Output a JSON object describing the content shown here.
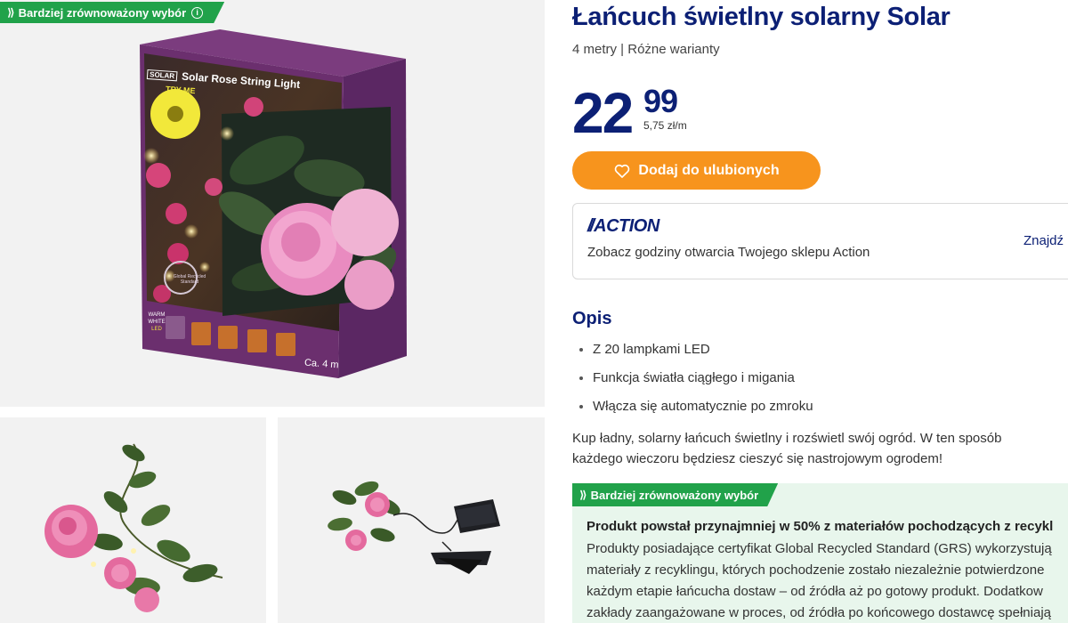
{
  "badge": {
    "eco_label": "Bardziej zrównoważony wybór"
  },
  "product": {
    "title": "Łańcuch świetlny solarny Solar",
    "subtitle": "4 metry | Różne warianty"
  },
  "price": {
    "integer": "22",
    "decimal": "99",
    "unit_price": "5,75 zł/m"
  },
  "favorite_button": {
    "label": "Dodaj do ulubionych"
  },
  "store": {
    "logo": "ACTION",
    "text": "Zobacz godziny otwarcia Twojego sklepu Action",
    "link": "Znajdź"
  },
  "package": {
    "brand": "SOLAR",
    "name": "Solar Rose String Light",
    "try_me": "TRY ME",
    "length": "Ca. 4 m",
    "warm_white": "WARM WHITE",
    "led": "LED",
    "recycled": "Global Recycled Standard"
  },
  "description": {
    "heading": "Opis",
    "features": [
      "Z 20 lampkami LED",
      "Funkcja światła ciągłego i migania",
      "Włącza się automatycznie po zmroku"
    ],
    "text": "Kup ładny, solarny łańcuch świetlny i rozświetl swój ogród. W ten sposób każdego wieczoru będziesz cieszyć się nastrojowym ogrodem!"
  },
  "sustainability": {
    "label": "Bardziej zrównoważony wybór",
    "title": "Produkt powstał przynajmniej w 50% z materiałów pochodzących z recykl",
    "lines": [
      "Produkty posiadające certyfikat Global Recycled Standard (GRS) wykorzystują",
      "materiały z recyklingu, których pochodzenie zostało niezależnie potwierdzone",
      "każdym etapie łańcucha dostaw – od źródła aż po gotowy produkt. Dodatkow",
      "zakłady zaangażowane w proces, od źródła po końcowego dostawcę spełniają"
    ]
  },
  "colors": {
    "brand_blue": "#0c2075",
    "eco_green": "#21a24a",
    "eco_panel_bg": "#e8f6ec",
    "favorite_orange": "#f7941d",
    "package_purple": "#6b2f6e"
  }
}
